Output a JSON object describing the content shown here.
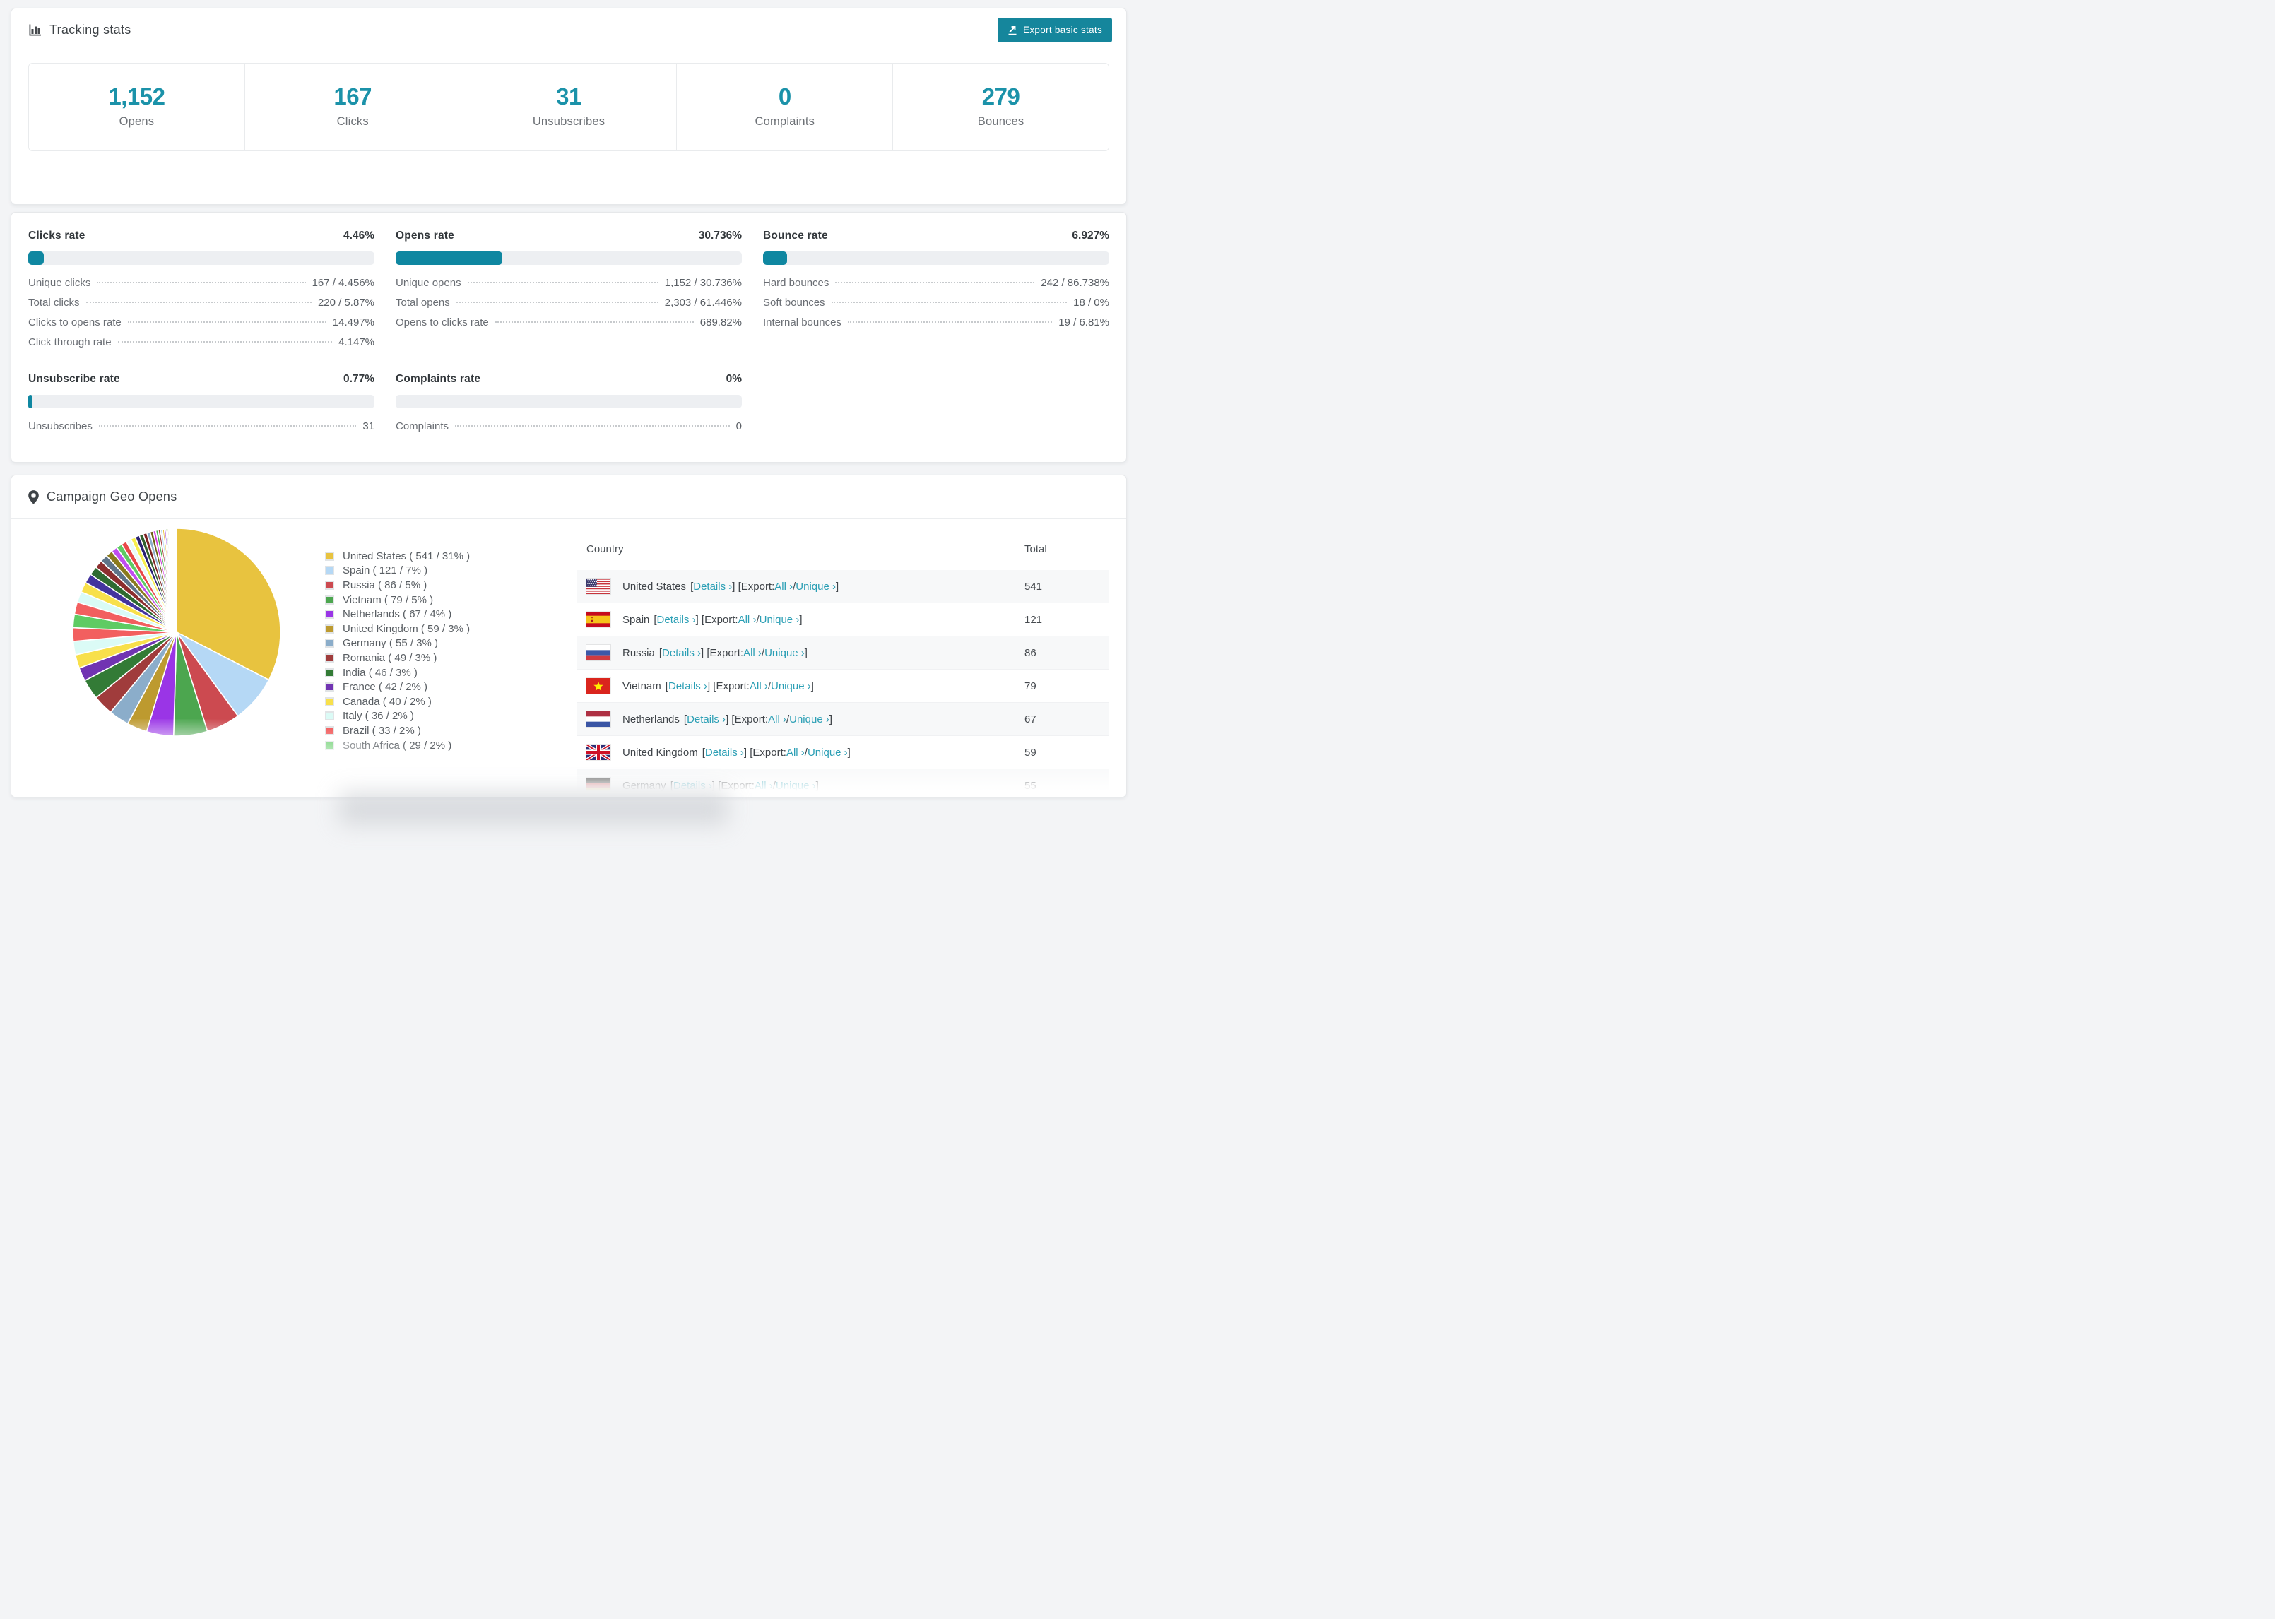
{
  "colors": {
    "accent_teal": "#15869c",
    "number_teal": "#1b92a9",
    "bar_fill": "#0f87a1",
    "bar_track": "#edeff2",
    "link_teal": "#2b9fb5"
  },
  "tracking_stats": {
    "title": "Tracking stats",
    "export_button_label": "Export basic stats",
    "summary": [
      {
        "value": "1,152",
        "label": "Opens"
      },
      {
        "value": "167",
        "label": "Clicks"
      },
      {
        "value": "31",
        "label": "Unsubscribes"
      },
      {
        "value": "0",
        "label": "Complaints"
      },
      {
        "value": "279",
        "label": "Bounces"
      }
    ]
  },
  "rates": [
    {
      "id": "clicks-rate",
      "title": "Clicks rate",
      "value": "4.46%",
      "bar_pct": 4.46,
      "rows": [
        {
          "label": "Unique clicks",
          "value": "167 / 4.456%"
        },
        {
          "label": "Total clicks",
          "value": "220 / 5.87%"
        },
        {
          "label": "Clicks to opens rate",
          "value": "14.497%"
        },
        {
          "label": "Click through rate",
          "value": "4.147%"
        }
      ]
    },
    {
      "id": "opens-rate",
      "title": "Opens rate",
      "value": "30.736%",
      "bar_pct": 30.736,
      "rows": [
        {
          "label": "Unique opens",
          "value": "1,152 / 30.736%"
        },
        {
          "label": "Total opens",
          "value": "2,303 / 61.446%"
        },
        {
          "label": "Opens to clicks rate",
          "value": "689.82%"
        }
      ]
    },
    {
      "id": "bounce-rate",
      "title": "Bounce rate",
      "value": "6.927%",
      "bar_pct": 6.927,
      "rows": [
        {
          "label": "Hard bounces",
          "value": "242 / 86.738%"
        },
        {
          "label": "Soft bounces",
          "value": "18 / 0%"
        },
        {
          "label": "Internal bounces",
          "value": "19 / 6.81%"
        }
      ]
    },
    {
      "id": "unsubscribe-rate",
      "title": "Unsubscribe rate",
      "value": "0.77%",
      "bar_pct": 0.77,
      "rows": [
        {
          "label": "Unsubscribes",
          "value": "31"
        }
      ]
    },
    {
      "id": "complaints-rate",
      "title": "Complaints rate",
      "value": "0%",
      "bar_pct": 0,
      "rows": [
        {
          "label": "Complaints",
          "value": "0"
        }
      ]
    }
  ],
  "geo": {
    "title": "Campaign Geo Opens",
    "legend": [
      "United States ( 541 / 31% )",
      "Spain ( 121 / 7% )",
      "Russia ( 86 / 5% )",
      "Vietnam ( 79 / 5% )",
      "Netherlands ( 67 / 4% )",
      "United Kingdom ( 59 / 3% )",
      "Germany ( 55 / 3% )",
      "Romania ( 49 / 3% )",
      "India ( 46 / 3% )",
      "France ( 42 / 2% )",
      "Canada ( 40 / 2% )",
      "Italy ( 36 / 2% )",
      "Brazil ( 33 / 2% )",
      "South Africa ( 29 / 2% )"
    ],
    "table": {
      "columns": [
        "Country",
        "Total"
      ],
      "link_labels": {
        "bracket_open": "[",
        "bracket_close": "]",
        "details": "Details ›",
        "export_label": "Export:",
        "all": "All ›",
        "separator": "/",
        "unique": "Unique ›"
      },
      "rows": [
        {
          "country": "United States",
          "total": "541",
          "flag": "us",
          "partial": false
        },
        {
          "country": "Spain",
          "total": "121",
          "flag": "es",
          "partial": false
        },
        {
          "country": "Russia",
          "total": "86",
          "flag": "ru",
          "partial": false
        },
        {
          "country": "Vietnam",
          "total": "79",
          "flag": "vn",
          "partial": false
        },
        {
          "country": "Netherlands",
          "total": "67",
          "flag": "nl",
          "partial": false
        },
        {
          "country": "United Kingdom",
          "total": "59",
          "flag": "gb",
          "partial": false
        },
        {
          "country": "Germany",
          "total": "55",
          "flag": "de",
          "partial": true
        }
      ]
    }
  },
  "chart_data": {
    "type": "pie",
    "title": "Campaign Geo Opens",
    "legend_position": "right",
    "slices": [
      {
        "label": "United States",
        "value": 541,
        "pct": 31,
        "color": "#e8c33f"
      },
      {
        "label": "Spain",
        "value": 121,
        "pct": 7,
        "color": "#b5d8f5"
      },
      {
        "label": "Russia",
        "value": 86,
        "pct": 5,
        "color": "#cc4a50"
      },
      {
        "label": "Vietnam",
        "value": 79,
        "pct": 5,
        "color": "#4ca64f"
      },
      {
        "label": "Netherlands",
        "value": 67,
        "pct": 4,
        "color": "#9a35e6"
      },
      {
        "label": "United Kingdom",
        "value": 59,
        "pct": 3,
        "color": "#bd9a2f"
      },
      {
        "label": "Germany",
        "value": 55,
        "pct": 3,
        "color": "#8badca"
      },
      {
        "label": "Romania",
        "value": 49,
        "pct": 3,
        "color": "#a03c3c"
      },
      {
        "label": "India",
        "value": 46,
        "pct": 3,
        "color": "#337b36"
      },
      {
        "label": "France",
        "value": 42,
        "pct": 2,
        "color": "#7134b2"
      },
      {
        "label": "Canada",
        "value": 40,
        "pct": 2,
        "color": "#f8e04b"
      },
      {
        "label": "Italy",
        "value": 36,
        "pct": 2,
        "color": "#dbfbf6"
      },
      {
        "label": "Brazil",
        "value": 33,
        "pct": 2,
        "color": "#f25f5f"
      },
      {
        "label": "South Africa",
        "value": 29,
        "pct": 2,
        "color": "#5fcb63"
      }
    ],
    "others_estimated_pcts": [
      1.8,
      1.6,
      1.5,
      1.4,
      1.3,
      1.2,
      1.1,
      1.0,
      0.9,
      0.85,
      0.8,
      0.75,
      0.7,
      0.65,
      0.6,
      0.55,
      0.5,
      0.45,
      0.4,
      0.36,
      0.33,
      0.3,
      0.27,
      0.24,
      0.21,
      0.19,
      0.17,
      0.15,
      0.13,
      0.11,
      0.1,
      0.09,
      0.08,
      0.07,
      0.06,
      0.05,
      0.05,
      0.04,
      0.04,
      0.03
    ],
    "others_palette": [
      "#f25f5f",
      "#d9fbf6",
      "#f8e04b",
      "#43349e",
      "#2e6b31",
      "#8c2e2e",
      "#5f7488",
      "#8a7a1e",
      "#c04df0",
      "#5fcb63",
      "#e84848",
      "#e8fbf8",
      "#f6ef4d",
      "#2a2272",
      "#33612f",
      "#7d2020",
      "#8badca",
      "#6b5e12",
      "#d13be2",
      "#45b24a",
      "#a93c3c",
      "#b5d8f5",
      "#e8c33f",
      "#9a35e6",
      "#4ca64f",
      "#bd9a2f",
      "#f25f5f",
      "#dbfbf6",
      "#f8e04b",
      "#7134b2",
      "#337b36",
      "#cc4a50",
      "#5fcb63",
      "#b5d8f5",
      "#c04df0",
      "#e8c33f",
      "#2a2272",
      "#8c2e2e",
      "#45b24a",
      "#d13be2"
    ]
  }
}
